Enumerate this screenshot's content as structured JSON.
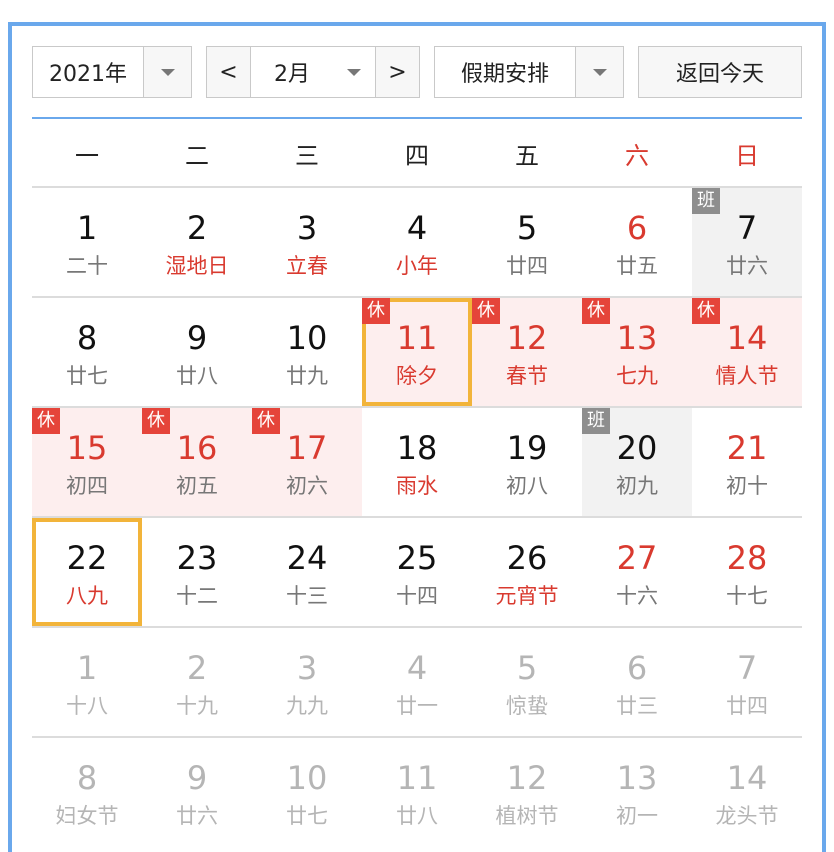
{
  "toolbar": {
    "year": "2021年",
    "prev": "<",
    "month": "2月",
    "next": ">",
    "holiday_select": "假期安排",
    "today_button": "返回今天"
  },
  "weekdays": [
    "一",
    "二",
    "三",
    "四",
    "五",
    "六",
    "日"
  ],
  "badge_labels": {
    "rest": "休",
    "work": "班"
  },
  "colors": {
    "accent": "#6aa8ec",
    "holiday_red": "#d93a2f",
    "selected": "#f2b43a",
    "rest_badge": "#e5443a",
    "work_badge": "#8e8e8e"
  },
  "weeks": [
    [
      {
        "day": "1",
        "sub": "二十"
      },
      {
        "day": "2",
        "sub": "湿地日",
        "redSub": true
      },
      {
        "day": "3",
        "sub": "立春",
        "redSub": true
      },
      {
        "day": "4",
        "sub": "小年",
        "redSub": true
      },
      {
        "day": "5",
        "sub": "廿四"
      },
      {
        "day": "6",
        "sub": "廿五",
        "redNum": true
      },
      {
        "day": "7",
        "sub": "廿六",
        "badge": "work"
      }
    ],
    [
      {
        "day": "8",
        "sub": "廿七"
      },
      {
        "day": "9",
        "sub": "廿八"
      },
      {
        "day": "10",
        "sub": "廿九"
      },
      {
        "day": "11",
        "sub": "除夕",
        "redNum": true,
        "redSub": true,
        "badge": "rest",
        "selected": true
      },
      {
        "day": "12",
        "sub": "春节",
        "redNum": true,
        "redSub": true,
        "badge": "rest"
      },
      {
        "day": "13",
        "sub": "七九",
        "redNum": true,
        "redSub": true,
        "badge": "rest"
      },
      {
        "day": "14",
        "sub": "情人节",
        "redNum": true,
        "redSub": true,
        "badge": "rest"
      }
    ],
    [
      {
        "day": "15",
        "sub": "初四",
        "redNum": true,
        "badge": "rest"
      },
      {
        "day": "16",
        "sub": "初五",
        "redNum": true,
        "badge": "rest"
      },
      {
        "day": "17",
        "sub": "初六",
        "redNum": true,
        "badge": "rest"
      },
      {
        "day": "18",
        "sub": "雨水",
        "redSub": true
      },
      {
        "day": "19",
        "sub": "初八"
      },
      {
        "day": "20",
        "sub": "初九",
        "badge": "work"
      },
      {
        "day": "21",
        "sub": "初十",
        "redNum": true
      }
    ],
    [
      {
        "day": "22",
        "sub": "八九",
        "redSub": true,
        "selected": true
      },
      {
        "day": "23",
        "sub": "十二"
      },
      {
        "day": "24",
        "sub": "十三"
      },
      {
        "day": "25",
        "sub": "十四"
      },
      {
        "day": "26",
        "sub": "元宵节",
        "redSub": true
      },
      {
        "day": "27",
        "sub": "十六",
        "redNum": true
      },
      {
        "day": "28",
        "sub": "十七",
        "redNum": true
      }
    ],
    [
      {
        "day": "1",
        "sub": "十八",
        "other": true
      },
      {
        "day": "2",
        "sub": "十九",
        "other": true
      },
      {
        "day": "3",
        "sub": "九九",
        "other": true
      },
      {
        "day": "4",
        "sub": "廿一",
        "other": true
      },
      {
        "day": "5",
        "sub": "惊蛰",
        "other": true
      },
      {
        "day": "6",
        "sub": "廿三",
        "other": true
      },
      {
        "day": "7",
        "sub": "廿四",
        "other": true
      }
    ],
    [
      {
        "day": "8",
        "sub": "妇女节",
        "other": true
      },
      {
        "day": "9",
        "sub": "廿六",
        "other": true
      },
      {
        "day": "10",
        "sub": "廿七",
        "other": true
      },
      {
        "day": "11",
        "sub": "廿八",
        "other": true
      },
      {
        "day": "12",
        "sub": "植树节",
        "other": true
      },
      {
        "day": "13",
        "sub": "初一",
        "other": true
      },
      {
        "day": "14",
        "sub": "龙头节",
        "other": true
      }
    ]
  ]
}
